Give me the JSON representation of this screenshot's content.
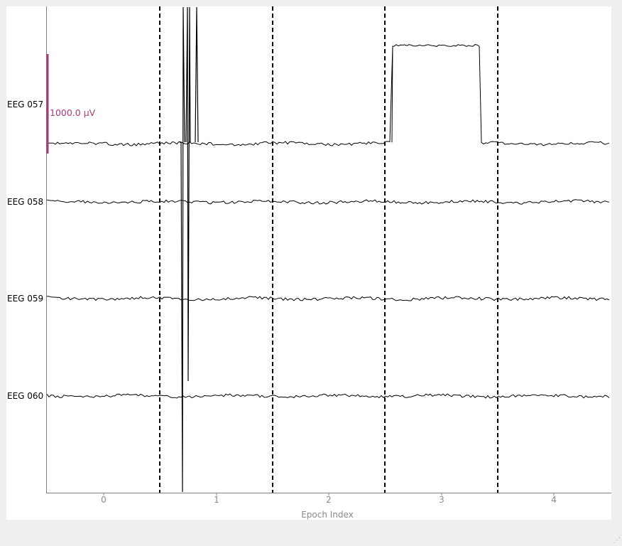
{
  "channels": [
    {
      "label": "EEG 057"
    },
    {
      "label": "EEG 058"
    },
    {
      "label": "EEG 059"
    },
    {
      "label": "EEG 060"
    }
  ],
  "xaxis": {
    "label": "Epoch Index",
    "ticks": [
      "0",
      "1",
      "2",
      "3",
      "4"
    ]
  },
  "scale_bar": {
    "label": "1000.0 µV",
    "color": "#a83a76"
  },
  "epoch_boundary_style": "dashed",
  "colors": {
    "trace": "#000000",
    "axis": "#808080",
    "tick_text": "#8a8a8a",
    "background": "#ffffff",
    "window": "#efefef"
  }
}
